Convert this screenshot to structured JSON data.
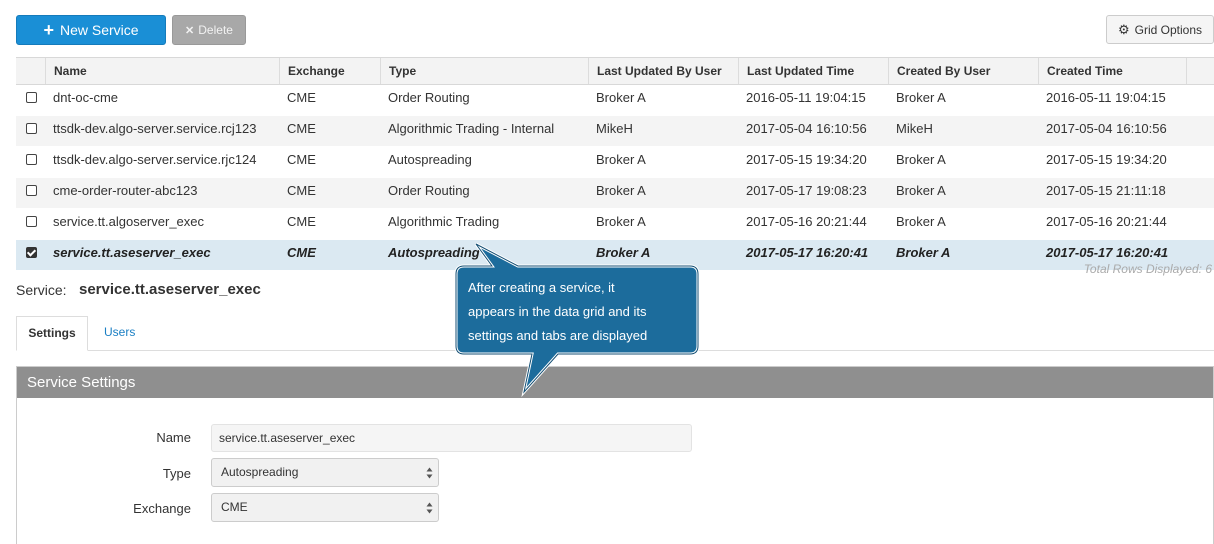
{
  "toolbar": {
    "new_service_label": "New Service",
    "delete_label": "Delete",
    "grid_options_label": "Grid Options"
  },
  "grid": {
    "columns": [
      "Name",
      "Exchange",
      "Type",
      "Last Updated By User",
      "Last Updated Time",
      "Created By User",
      "Created Time"
    ],
    "rows": [
      {
        "checked": false,
        "name": "dnt-oc-cme",
        "exchange": "CME",
        "type": "Order Routing",
        "updated_by": "Broker A",
        "updated_time": "2016-05-11 19:04:15",
        "created_by": "Broker A",
        "created_time": "2016-05-11 19:04:15"
      },
      {
        "checked": false,
        "name": "ttsdk-dev.algo-server.service.rcj123",
        "exchange": "CME",
        "type": "Algorithmic Trading - Internal",
        "updated_by": "MikeH",
        "updated_time": "2017-05-04 16:10:56",
        "created_by": "MikeH",
        "created_time": "2017-05-04 16:10:56"
      },
      {
        "checked": false,
        "name": "ttsdk-dev.algo-server.service.rjc124",
        "exchange": "CME",
        "type": "Autospreading",
        "updated_by": "Broker A",
        "updated_time": "2017-05-15 19:34:20",
        "created_by": "Broker A",
        "created_time": "2017-05-15 19:34:20"
      },
      {
        "checked": false,
        "name": "cme-order-router-abc123",
        "exchange": "CME",
        "type": "Order Routing",
        "updated_by": "Broker A",
        "updated_time": "2017-05-17 19:08:23",
        "created_by": "Broker A",
        "created_time": "2017-05-15 21:11:18"
      },
      {
        "checked": false,
        "name": "service.tt.algoserver_exec",
        "exchange": "CME",
        "type": "Algorithmic Trading",
        "updated_by": "Broker A",
        "updated_time": "2017-05-16 20:21:44",
        "created_by": "Broker A",
        "created_time": "2017-05-16 20:21:44"
      },
      {
        "checked": true,
        "name": "service.tt.aseserver_exec",
        "exchange": "CME",
        "type": "Autospreading",
        "updated_by": "Broker A",
        "updated_time": "2017-05-17 16:20:41",
        "created_by": "Broker A",
        "created_time": "2017-05-17 16:20:41"
      }
    ],
    "total_rows_text": "Total Rows Displayed: 6"
  },
  "service": {
    "label": "Service:",
    "name": "service.tt.aseserver_exec"
  },
  "tabs": [
    {
      "label": "Settings",
      "active": true
    },
    {
      "label": "Users",
      "active": false
    }
  ],
  "settings_panel": {
    "title": "Service Settings",
    "fields": {
      "name_label": "Name",
      "name_value": "service.tt.aseserver_exec",
      "type_label": "Type",
      "type_value": "Autospreading",
      "exchange_label": "Exchange",
      "exchange_value": "CME"
    }
  },
  "callout": {
    "lines": [
      "After creating a service, it",
      "appears in the data grid and its",
      "settings and tabs are displayed"
    ]
  },
  "colors": {
    "primary": "#1a8fd6",
    "callout_bg": "#1c6c9c",
    "selected_row": "#dbe9f2",
    "panel_header": "#8f8f8f"
  },
  "icons": {
    "new": "plus-icon",
    "delete": "x-icon",
    "grid_options": "gear-icon"
  }
}
